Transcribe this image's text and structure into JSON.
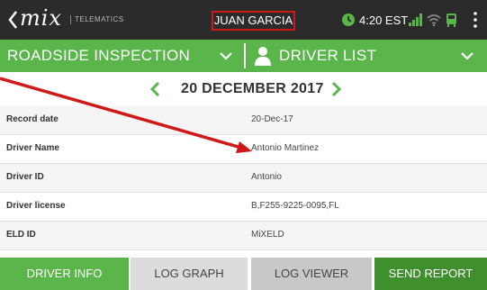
{
  "header": {
    "logo_text": "mix",
    "logo_subtitle": "TELEMATICS",
    "user_name": "JUAN GARCIA",
    "time": "4:20 EST"
  },
  "nav": {
    "left_label": "ROADSIDE INSPECTION",
    "right_label": "DRIVER LIST"
  },
  "date": {
    "label": "20 DECEMBER 2017"
  },
  "rows": [
    {
      "label": "Record date",
      "value": "20-Dec-17"
    },
    {
      "label": "Driver Name",
      "value": "Antonio Martinez"
    },
    {
      "label": "Driver ID",
      "value": "Antonio"
    },
    {
      "label": "Driver license",
      "value": "B,F255-9225-0095,FL"
    },
    {
      "label": "ELD ID",
      "value": "MiXELD"
    }
  ],
  "tabs": {
    "driver_info": "DRIVER INFO",
    "log_graph": "LOG GRAPH",
    "log_viewer": "LOG VIEWER",
    "send_report": "SEND REPORT"
  },
  "colors": {
    "accent_green": "#5ab54a",
    "dark_green": "#3f8f2f",
    "header_bg": "#2b2b2b",
    "highlight_red": "#d01818"
  },
  "icons": {
    "back": "chevron-left-icon",
    "clock": "clock-icon",
    "signal": "signal-icon",
    "wifi": "wifi-icon",
    "bus": "bus-icon",
    "menu": "more-vertical-icon",
    "person": "person-icon"
  }
}
